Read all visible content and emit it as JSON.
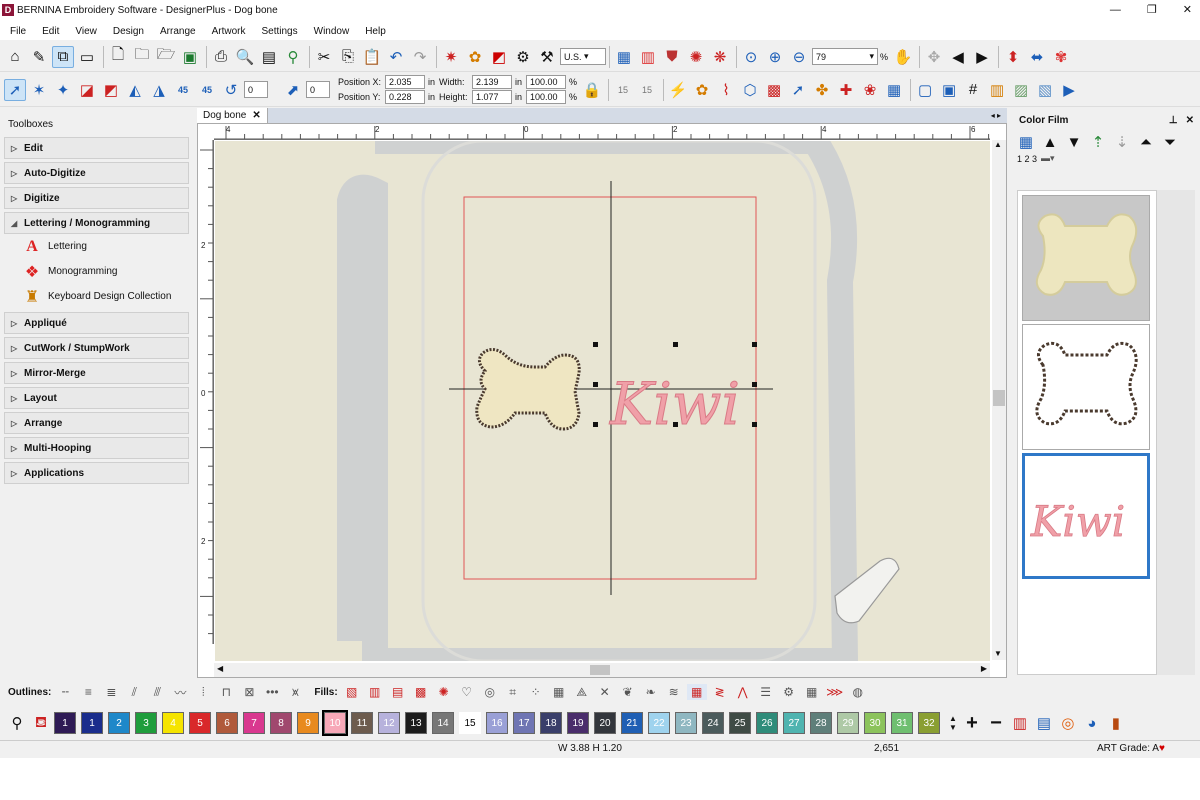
{
  "window": {
    "app_icon": "D",
    "title": "BERNINA Embroidery Software - DesignerPlus - Dog bone",
    "minimize": "—",
    "maximize": "❐",
    "close": "✕"
  },
  "menu": [
    "File",
    "Edit",
    "View",
    "Design",
    "Arrange",
    "Artwork",
    "Settings",
    "Window",
    "Help"
  ],
  "toolbar": {
    "units": "U.S.",
    "zoom": "79",
    "zoom_unit": "%",
    "rotate_value": "0",
    "slant_value": "0",
    "position_x_label": "Position X:",
    "position_x": "2.035",
    "position_y_label": "Position Y:",
    "position_y": "0.228",
    "width_label": "Width:",
    "width": "2.139",
    "height_label": "Height:",
    "height": "1.077",
    "unit_in": "in",
    "scale_w": "100.00",
    "scale_h": "100.00",
    "pct": "%",
    "rotate45_ccw": "45",
    "rotate45_cw": "45",
    "shape15a": "15",
    "shape15b": "15"
  },
  "toolboxes": {
    "title": "Toolboxes",
    "items": [
      {
        "label": "Edit",
        "expanded": false
      },
      {
        "label": "Auto-Digitize",
        "expanded": false
      },
      {
        "label": "Digitize",
        "expanded": false
      },
      {
        "label": "Lettering / Monogramming",
        "expanded": true
      },
      {
        "label": "Appliqué",
        "expanded": false
      },
      {
        "label": "CutWork / StumpWork",
        "expanded": false
      },
      {
        "label": "Mirror-Merge",
        "expanded": false
      },
      {
        "label": "Layout",
        "expanded": false
      },
      {
        "label": "Arrange",
        "expanded": false
      },
      {
        "label": "Multi-Hooping",
        "expanded": false
      },
      {
        "label": "Applications",
        "expanded": false
      }
    ],
    "lettering_tools": [
      "Lettering",
      "Monogramming",
      "Keyboard Design Collection"
    ]
  },
  "document": {
    "tab_label": "Dog bone",
    "tab_close": "✕",
    "ruler_h": [
      "4",
      "2",
      "0",
      "2",
      "4",
      "6"
    ],
    "ruler_v": [
      "2",
      "0",
      "2"
    ],
    "lettering_text": "Kiwi"
  },
  "color_film": {
    "title": "Color Film",
    "pin": "⊥",
    "close": "✕",
    "sequence_label": "1 2 3",
    "items": [
      {
        "kind": "bone-fill",
        "color": "#ede6bf"
      },
      {
        "kind": "bone-outline",
        "color": "#4a3a2e"
      },
      {
        "kind": "text",
        "text": "Kiwi",
        "color": "#e98995",
        "selected": true
      }
    ]
  },
  "stitchbar": {
    "outlines_label": "Outlines:",
    "fills_label": "Fills:"
  },
  "palette": [
    {
      "n": "1",
      "color": "#2e1a55"
    },
    {
      "n": "1",
      "color": "#1a2d8c"
    },
    {
      "n": "2",
      "color": "#1e88c9"
    },
    {
      "n": "3",
      "color": "#1f9d3c"
    },
    {
      "n": "4",
      "color": "#f5e400"
    },
    {
      "n": "5",
      "color": "#d9282a"
    },
    {
      "n": "6",
      "color": "#b05a3b"
    },
    {
      "n": "7",
      "color": "#d9388f"
    },
    {
      "n": "8",
      "color": "#a0486e"
    },
    {
      "n": "9",
      "color": "#e88a1e"
    },
    {
      "n": "10",
      "color": "#f7a8b8"
    },
    {
      "n": "11",
      "color": "#6d5c4e"
    },
    {
      "n": "12",
      "color": "#b7b2dc"
    },
    {
      "n": "13",
      "color": "#1c1c1c"
    },
    {
      "n": "14",
      "color": "#777777"
    },
    {
      "n": "15",
      "color": "#ffffff"
    },
    {
      "n": "16",
      "color": "#9aa0d6"
    },
    {
      "n": "17",
      "color": "#6f75b3"
    },
    {
      "n": "18",
      "color": "#3a3f6a"
    },
    {
      "n": "19",
      "color": "#4a2d6b"
    },
    {
      "n": "20",
      "color": "#33363c"
    },
    {
      "n": "21",
      "color": "#1f5fb4"
    },
    {
      "n": "22",
      "color": "#9fd3ee"
    },
    {
      "n": "23",
      "color": "#8fb7c1"
    },
    {
      "n": "24",
      "color": "#4b5b5c"
    },
    {
      "n": "25",
      "color": "#3f4b45"
    },
    {
      "n": "26",
      "color": "#2f8c7a"
    },
    {
      "n": "27",
      "color": "#4fb4b0"
    },
    {
      "n": "28",
      "color": "#5f7f7a"
    },
    {
      "n": "29",
      "color": "#aec9a6"
    },
    {
      "n": "30",
      "color": "#8cc35c"
    },
    {
      "n": "31",
      "color": "#6fbf70"
    },
    {
      "n": "32",
      "color": "#8a9f32"
    }
  ],
  "status": {
    "size": "W 3.88 H 1.20",
    "stitches": "2,651",
    "art_grade": "ART Grade: A",
    "heart": "♥"
  }
}
